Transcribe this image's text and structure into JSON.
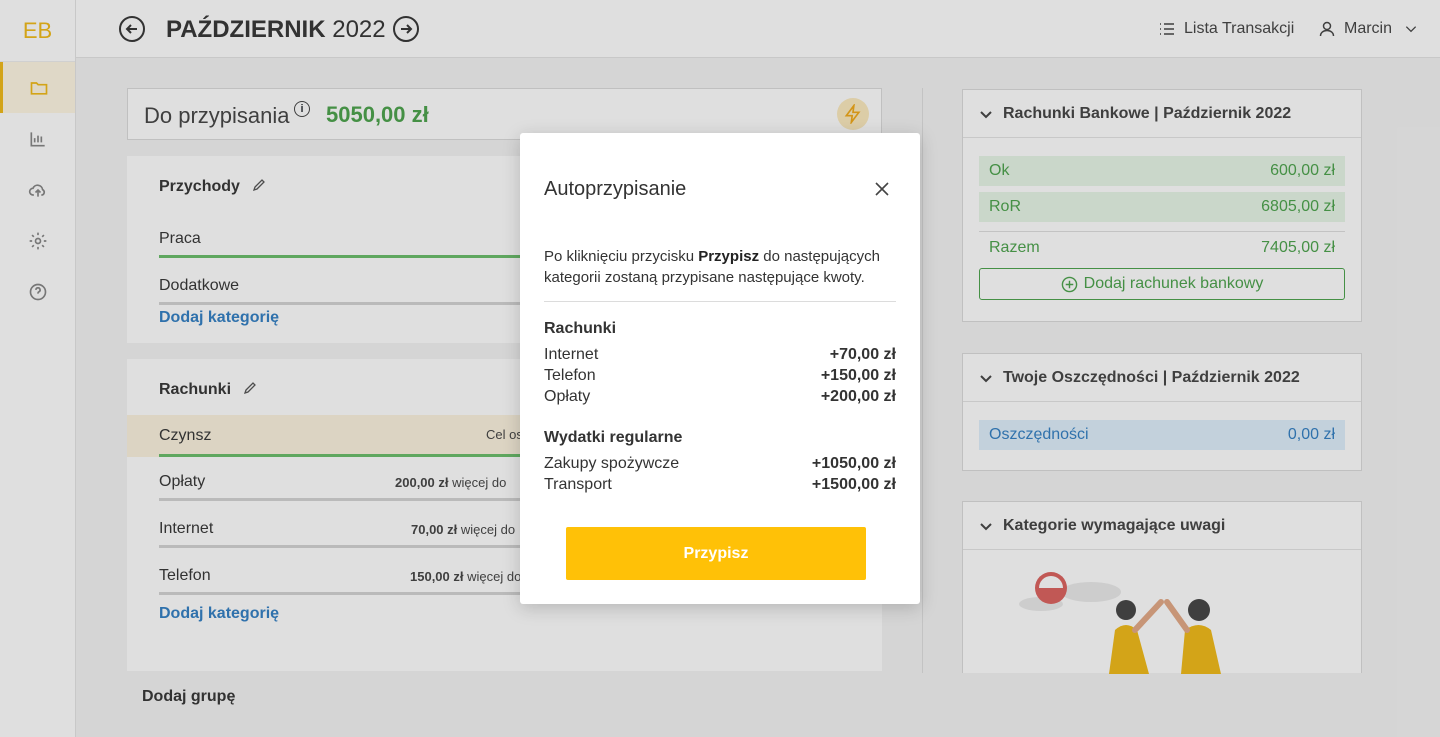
{
  "app": {
    "logo": "EB"
  },
  "sidebar": {
    "items": [
      {
        "icon": "folder-icon",
        "active": true
      },
      {
        "icon": "chart-icon",
        "active": false
      },
      {
        "icon": "upload-icon",
        "active": false
      },
      {
        "icon": "gear-icon",
        "active": false
      },
      {
        "icon": "help-icon",
        "active": false
      }
    ]
  },
  "header": {
    "month": "PAŹDZIERNIK",
    "year": "2022",
    "transactions_link": "Lista Transakcji",
    "user": "Marcin"
  },
  "assign": {
    "label": "Do przypisania",
    "amount": "5050,00 zł"
  },
  "groups": {
    "income": {
      "title": "Przychody",
      "items": [
        {
          "name": "Praca"
        },
        {
          "name": "Dodatkowe"
        }
      ],
      "add_label": "Dodaj kategorię"
    },
    "bills": {
      "title": "Rachunki",
      "items": [
        {
          "name": "Czynsz",
          "desc": "Cel os"
        },
        {
          "name": "Opłaty",
          "amount": "200,00 zł",
          "desc": "więcej do"
        },
        {
          "name": "Internet",
          "amount": "70,00 zł",
          "desc": "więcej do"
        },
        {
          "name": "Telefon",
          "amount": "150,00 zł",
          "desc": "więcej do"
        }
      ],
      "add_label": "Dodaj kategorię"
    },
    "add_group": "Dodaj grupę"
  },
  "bank_panel": {
    "title": "Rachunki Bankowe | Październik 2022",
    "accounts": [
      {
        "name": "Ok",
        "value": "600,00 zł"
      },
      {
        "name": "RoR",
        "value": "6805,00 zł"
      }
    ],
    "total_label": "Razem",
    "total_value": "7405,00 zł",
    "add_label": "Dodaj rachunek bankowy"
  },
  "savings_panel": {
    "title": "Twoje Oszczędności | Październik 2022",
    "row_name": "Oszczędności",
    "row_value": "0,00 zł"
  },
  "attention_panel": {
    "title": "Kategorie wymagające uwagi"
  },
  "modal": {
    "title": "Autoprzypisanie",
    "desc_prefix": "Po kliknięciu przycisku ",
    "desc_bold": "Przypisz",
    "desc_suffix": " do następujących kategorii zostaną przypisane następujące kwoty.",
    "sections": [
      {
        "title": "Rachunki",
        "rows": [
          {
            "name": "Internet",
            "amount": "+70,00 zł"
          },
          {
            "name": "Telefon",
            "amount": "+150,00 zł"
          },
          {
            "name": "Opłaty",
            "amount": "+200,00 zł"
          }
        ]
      },
      {
        "title": "Wydatki regularne",
        "rows": [
          {
            "name": "Zakupy spożywcze",
            "amount": "+1050,00 zł"
          },
          {
            "name": "Transport",
            "amount": "+1500,00 zł"
          }
        ]
      }
    ],
    "button": "Przypisz"
  }
}
